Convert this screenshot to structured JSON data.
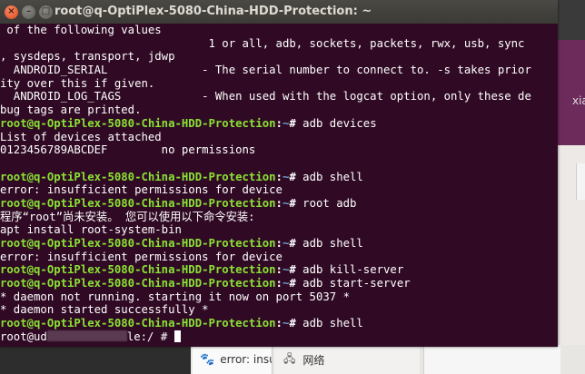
{
  "window": {
    "title": "root@q-OptiPlex-5080-China-HDD-Protection: ~",
    "controls": {
      "close": "×",
      "minimize": "–",
      "maximize": "□"
    }
  },
  "terminal": {
    "lines": [
      {
        "kind": "text",
        "text": " of the following values"
      },
      {
        "kind": "text",
        "text": "                               1 or all, adb, sockets, packets, rwx, usb, sync"
      },
      {
        "kind": "text",
        "text": ", sysdeps, transport, jdwp"
      },
      {
        "kind": "text",
        "text": "  ANDROID_SERIAL              - The serial number to connect to. -s takes prior"
      },
      {
        "kind": "text",
        "text": "ity over this if given."
      },
      {
        "kind": "text",
        "text": "  ANDROID_LOG_TAGS            - When used with the logcat option, only these de"
      },
      {
        "kind": "text",
        "text": "bug tags are printed."
      },
      {
        "kind": "prompt",
        "user": "root@q-OptiPlex-5080-China-HDD-Protection",
        "path": "~",
        "symbol": "# ",
        "cmd": "adb devices"
      },
      {
        "kind": "text",
        "text": "List of devices attached"
      },
      {
        "kind": "text",
        "text": "0123456789ABCDEF        no permissions"
      },
      {
        "kind": "text",
        "text": ""
      },
      {
        "kind": "prompt",
        "user": "root@q-OptiPlex-5080-China-HDD-Protection",
        "path": "~",
        "symbol": "# ",
        "cmd": "adb shell"
      },
      {
        "kind": "text",
        "text": "error: insufficient permissions for device"
      },
      {
        "kind": "prompt",
        "user": "root@q-OptiPlex-5080-China-HDD-Protection",
        "path": "~",
        "symbol": "# ",
        "cmd": "root adb"
      },
      {
        "kind": "text",
        "text": "程序“root”尚未安装。 您可以使用以下命令安装:"
      },
      {
        "kind": "text",
        "text": "apt install root-system-bin"
      },
      {
        "kind": "prompt",
        "user": "root@q-OptiPlex-5080-China-HDD-Protection",
        "path": "~",
        "symbol": "# ",
        "cmd": "adb shell"
      },
      {
        "kind": "text",
        "text": "error: insufficient permissions for device"
      },
      {
        "kind": "prompt",
        "user": "root@q-OptiPlex-5080-China-HDD-Protection",
        "path": "~",
        "symbol": "# ",
        "cmd": "adb kill-server"
      },
      {
        "kind": "prompt",
        "user": "root@q-OptiPlex-5080-China-HDD-Protection",
        "path": "~",
        "symbol": "# ",
        "cmd": "adb start-server"
      },
      {
        "kind": "text",
        "text": "* daemon not running. starting it now on port 5037 *"
      },
      {
        "kind": "text",
        "text": "* daemon started successfully *"
      },
      {
        "kind": "prompt",
        "user": "root@q-OptiPlex-5080-China-HDD-Protection",
        "path": "~",
        "symbol": "# ",
        "cmd": "adb shell"
      },
      {
        "kind": "shell",
        "before": "root@ud",
        "after": "le:/ # "
      }
    ]
  },
  "background": {
    "right_word": "xia",
    "bottom_error": "error: insuf",
    "bottom_network": "网络"
  }
}
